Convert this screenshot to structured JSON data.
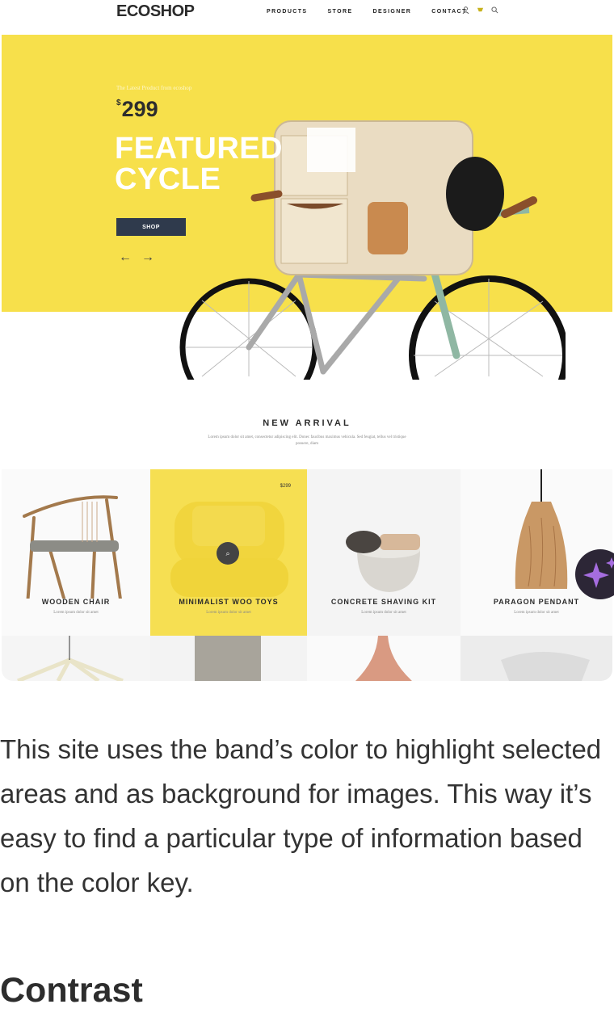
{
  "nav": {
    "logo": "ECOSHOP",
    "menu": [
      "PRODUCTS",
      "STORE",
      "DESIGNER",
      "CONTACT"
    ],
    "icons": [
      "user-icon",
      "cart-icon",
      "search-icon"
    ]
  },
  "hero": {
    "tagline": "The Latest Product from ecoshop",
    "price_symbol": "$",
    "price": "299",
    "title_line1": "FEATURED",
    "title_line2": "CYCLE",
    "button": "SHOP",
    "prev_arrow": "←",
    "next_arrow": "→"
  },
  "new_arrival": {
    "title": "NEW ARRIVAL",
    "description": "Lorem ipsum dolor sit amet, consectetur adipiscing elit. Donec faucibus maximus vehicula. Sed feugiat, tellus vel tristique posuere, diam"
  },
  "products": [
    {
      "name": "WOODEN CHAIR",
      "sub": "Lorem ipsum dolor sit amet",
      "price": ""
    },
    {
      "name": "MINIMALIST WOO TOYS",
      "sub": "Lorem ipsum dolor sit amet",
      "price": "$299"
    },
    {
      "name": "CONCRETE SHAVING KIT",
      "sub": "Lorem ipsum dolor sit amet",
      "price": ""
    },
    {
      "name": "PARAGON PENDANT",
      "sub": "Lorem ipsum dolor sit amet",
      "price": ""
    }
  ],
  "article": {
    "paragraph": "This site uses the band’s color to highlight selected areas and as background for images. This way it’s easy to find a particular type of information based on the color key.",
    "heading": "Contrast"
  },
  "colors": {
    "accent_yellow": "#f7e04b",
    "dark_button": "#2f3a4c"
  }
}
